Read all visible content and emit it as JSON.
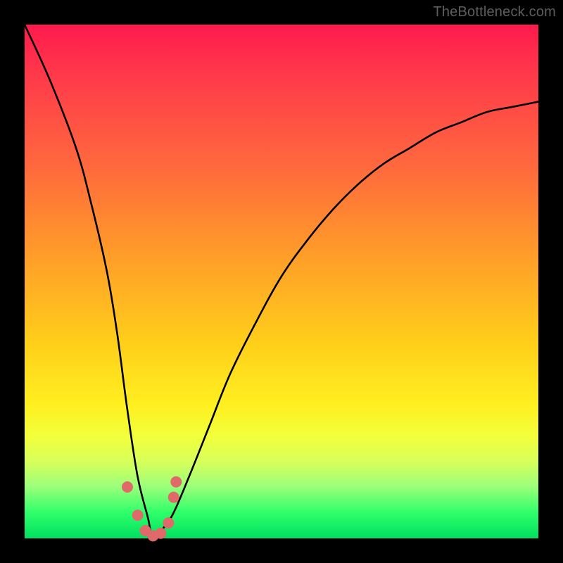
{
  "watermark": "TheBottleneck.com",
  "chart_data": {
    "type": "line",
    "title": "",
    "xlabel": "",
    "ylabel": "",
    "xlim": [
      0,
      100
    ],
    "ylim": [
      0,
      100
    ],
    "series": [
      {
        "name": "bottleneck-curve",
        "x": [
          0,
          5,
          10,
          13,
          16,
          18,
          20,
          22,
          24,
          25,
          27,
          29,
          32,
          36,
          40,
          45,
          50,
          55,
          60,
          65,
          70,
          75,
          80,
          85,
          90,
          95,
          100
        ],
        "y": [
          100,
          89,
          76,
          65,
          52,
          40,
          25,
          12,
          4,
          0,
          2,
          5,
          12,
          22,
          32,
          42,
          51,
          58,
          64,
          69,
          73,
          76,
          79,
          81,
          83,
          84,
          85
        ]
      }
    ],
    "markers": {
      "name": "highlighted-points",
      "points": [
        {
          "x": 20.0,
          "y": 10.0
        },
        {
          "x": 22.0,
          "y": 4.5
        },
        {
          "x": 23.5,
          "y": 1.5
        },
        {
          "x": 25.0,
          "y": 0.5
        },
        {
          "x": 26.5,
          "y": 1.0
        },
        {
          "x": 28.0,
          "y": 3.0
        },
        {
          "x": 29.0,
          "y": 8.0
        },
        {
          "x": 29.5,
          "y": 11.0
        }
      ],
      "color": "#e06a6a",
      "radius_px": 8
    },
    "gradient_stops": [
      {
        "pct": 0,
        "color": "#ff1a4d"
      },
      {
        "pct": 28,
        "color": "#ff6a3d"
      },
      {
        "pct": 62,
        "color": "#ffcf1a"
      },
      {
        "pct": 85,
        "color": "#d8ff5a"
      },
      {
        "pct": 100,
        "color": "#00e060"
      }
    ]
  }
}
